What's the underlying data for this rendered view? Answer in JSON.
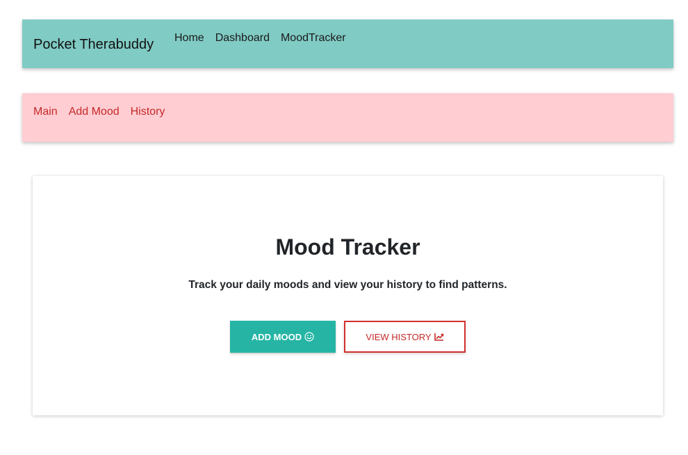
{
  "navbar": {
    "brand": "Pocket Therabuddy",
    "links": [
      "Home",
      "Dashboard",
      "MoodTracker"
    ]
  },
  "subnav": {
    "links": [
      "Main",
      "Add Mood",
      "History"
    ]
  },
  "card": {
    "title": "Mood Tracker",
    "text": "Track your daily moods and view your history to find patterns.",
    "add_button": "ADD MOOD",
    "history_button": "VIEW HISTORY"
  },
  "icons": {
    "add": "smiley-icon",
    "history": "line-chart-icon"
  },
  "colors": {
    "navbar_bg": "#80cbc4",
    "subnav_bg": "#ffcdd2",
    "primary": "#26b5a5",
    "accent": "#c62828"
  }
}
